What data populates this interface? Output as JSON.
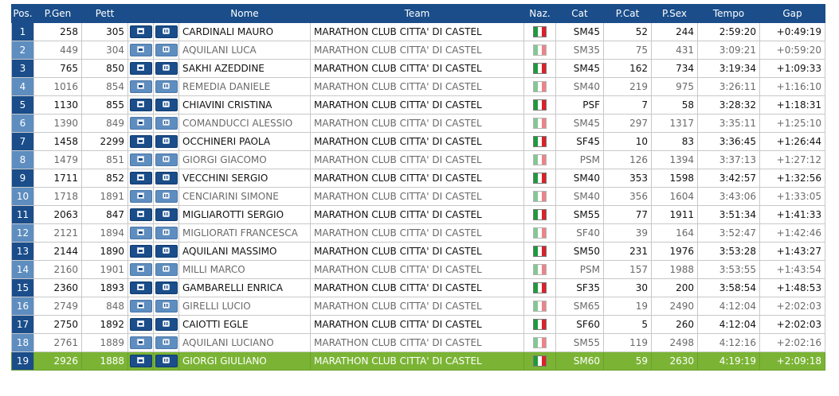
{
  "columns": [
    "Pos.",
    "P.Gen",
    "Pett",
    "",
    "",
    "Nome",
    "Team",
    "Naz.",
    "Cat",
    "P.Cat",
    "P.Sex",
    "Tempo",
    "Gap"
  ],
  "icons": {
    "photo": "photo-icon",
    "video": "video-icon",
    "flag": "italy-flag-icon"
  },
  "colors": {
    "header": "#1a4d8a",
    "dark_pos": "#1a4d8a",
    "light_pos": "#5e8dc0",
    "highlight": "#7bb435"
  },
  "rows": [
    {
      "pos": "1",
      "pgen": "258",
      "pett": "305",
      "name": "CARDINALI MAURO",
      "team": "MARATHON CLUB CITTA' DI CASTEL",
      "cat": "SM45",
      "pcat": "52",
      "psex": "244",
      "tempo": "2:59:20",
      "gap": "+0:49:19"
    },
    {
      "pos": "2",
      "pgen": "449",
      "pett": "304",
      "name": "AQUILANI LUCA",
      "team": "MARATHON CLUB CITTA' DI CASTEL",
      "cat": "SM35",
      "pcat": "75",
      "psex": "431",
      "tempo": "3:09:21",
      "gap": "+0:59:20"
    },
    {
      "pos": "3",
      "pgen": "765",
      "pett": "850",
      "name": "SAKHI AZEDDINE",
      "team": "MARATHON CLUB CITTA' DI CASTEL",
      "cat": "SM45",
      "pcat": "162",
      "psex": "734",
      "tempo": "3:19:34",
      "gap": "+1:09:33"
    },
    {
      "pos": "4",
      "pgen": "1016",
      "pett": "854",
      "name": "REMEDIA DANIELE",
      "team": "MARATHON CLUB CITTA' DI CASTEL",
      "cat": "SM40",
      "pcat": "219",
      "psex": "975",
      "tempo": "3:26:11",
      "gap": "+1:16:10"
    },
    {
      "pos": "5",
      "pgen": "1130",
      "pett": "855",
      "name": "CHIAVINI CRISTINA",
      "team": "MARATHON CLUB CITTA' DI CASTEL",
      "cat": "PSF",
      "pcat": "7",
      "psex": "58",
      "tempo": "3:28:32",
      "gap": "+1:18:31"
    },
    {
      "pos": "6",
      "pgen": "1390",
      "pett": "849",
      "name": "COMANDUCCI ALESSIO",
      "team": "MARATHON CLUB CITTA' DI CASTEL",
      "cat": "SM45",
      "pcat": "297",
      "psex": "1317",
      "tempo": "3:35:11",
      "gap": "+1:25:10"
    },
    {
      "pos": "7",
      "pgen": "1458",
      "pett": "2299",
      "name": "OCCHINERI PAOLA",
      "team": "MARATHON CLUB CITTA' DI CASTEL",
      "cat": "SF45",
      "pcat": "10",
      "psex": "83",
      "tempo": "3:36:45",
      "gap": "+1:26:44"
    },
    {
      "pos": "8",
      "pgen": "1479",
      "pett": "851",
      "name": "GIORGI GIACOMO",
      "team": "MARATHON CLUB CITTA' DI CASTEL",
      "cat": "PSM",
      "pcat": "126",
      "psex": "1394",
      "tempo": "3:37:13",
      "gap": "+1:27:12"
    },
    {
      "pos": "9",
      "pgen": "1711",
      "pett": "852",
      "name": "VECCHINI SERGIO",
      "team": "MARATHON CLUB CITTA' DI CASTEL",
      "cat": "SM40",
      "pcat": "353",
      "psex": "1598",
      "tempo": "3:42:57",
      "gap": "+1:32:56"
    },
    {
      "pos": "10",
      "pgen": "1718",
      "pett": "1891",
      "name": "CENCIARINI SIMONE",
      "team": "MARATHON CLUB CITTA' DI CASTEL",
      "cat": "SM40",
      "pcat": "356",
      "psex": "1604",
      "tempo": "3:43:06",
      "gap": "+1:33:05"
    },
    {
      "pos": "11",
      "pgen": "2063",
      "pett": "847",
      "name": "MIGLIAROTTI SERGIO",
      "team": "MARATHON CLUB CITTA' DI CASTEL",
      "cat": "SM55",
      "pcat": "77",
      "psex": "1911",
      "tempo": "3:51:34",
      "gap": "+1:41:33"
    },
    {
      "pos": "12",
      "pgen": "2121",
      "pett": "1894",
      "name": "MIGLIORATI FRANCESCA",
      "team": "MARATHON CLUB CITTA' DI CASTEL",
      "cat": "SF40",
      "pcat": "39",
      "psex": "164",
      "tempo": "3:52:47",
      "gap": "+1:42:46"
    },
    {
      "pos": "13",
      "pgen": "2144",
      "pett": "1890",
      "name": "AQUILANI MASSIMO",
      "team": "MARATHON CLUB CITTA' DI CASTEL",
      "cat": "SM50",
      "pcat": "231",
      "psex": "1976",
      "tempo": "3:53:28",
      "gap": "+1:43:27"
    },
    {
      "pos": "14",
      "pgen": "2160",
      "pett": "1901",
      "name": "MILLI MARCO",
      "team": "MARATHON CLUB CITTA' DI CASTEL",
      "cat": "PSM",
      "pcat": "157",
      "psex": "1988",
      "tempo": "3:53:55",
      "gap": "+1:43:54"
    },
    {
      "pos": "15",
      "pgen": "2360",
      "pett": "1893",
      "name": "GAMBARELLI ENRICA",
      "team": "MARATHON CLUB CITTA' DI CASTEL",
      "cat": "SF35",
      "pcat": "30",
      "psex": "200",
      "tempo": "3:58:54",
      "gap": "+1:48:53"
    },
    {
      "pos": "16",
      "pgen": "2749",
      "pett": "848",
      "name": "GIRELLI LUCIO",
      "team": "MARATHON CLUB CITTA' DI CASTEL",
      "cat": "SM65",
      "pcat": "19",
      "psex": "2490",
      "tempo": "4:12:04",
      "gap": "+2:02:03"
    },
    {
      "pos": "17",
      "pgen": "2750",
      "pett": "1892",
      "name": "CAIOTTI EGLE",
      "team": "MARATHON CLUB CITTA' DI CASTEL",
      "cat": "SF60",
      "pcat": "5",
      "psex": "260",
      "tempo": "4:12:04",
      "gap": "+2:02:03"
    },
    {
      "pos": "18",
      "pgen": "2761",
      "pett": "1889",
      "name": "AQUILANI LUCIANO",
      "team": "MARATHON CLUB CITTA' DI CASTEL",
      "cat": "SM55",
      "pcat": "119",
      "psex": "2498",
      "tempo": "4:12:16",
      "gap": "+2:02:16"
    },
    {
      "pos": "19",
      "pgen": "2926",
      "pett": "1888",
      "name": "GIORGI GIULIANO",
      "team": "MARATHON CLUB CITTA' DI CASTEL",
      "cat": "SM60",
      "pcat": "59",
      "psex": "2630",
      "tempo": "4:19:19",
      "gap": "+2:09:18"
    }
  ]
}
